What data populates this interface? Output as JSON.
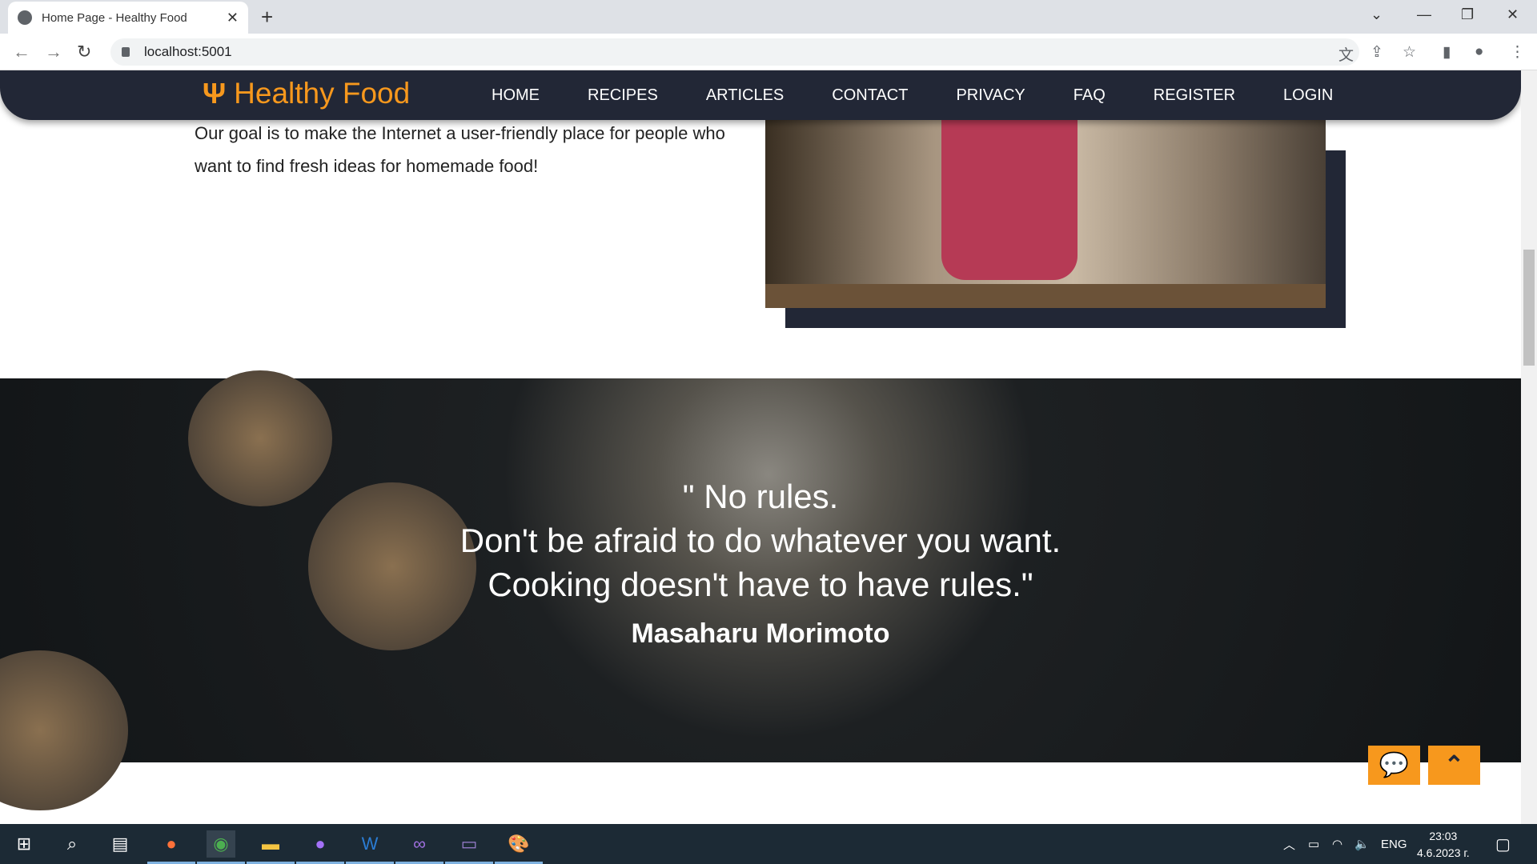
{
  "browser": {
    "tab_title": "Home Page - Healthy Food",
    "url": "localhost:5001"
  },
  "site": {
    "brand": "Healthy Food",
    "nav": [
      "HOME",
      "RECIPES",
      "ARTICLES",
      "CONTACT",
      "PRIVACY",
      "FAQ",
      "REGISTER",
      "LOGIN"
    ]
  },
  "intro": {
    "text": "Our goal is to make the Internet a user-friendly place for people who want to find fresh ideas for homemade food!"
  },
  "quote": {
    "line1": "\" No rules.",
    "line2": "Don't be afraid to do whatever you want.",
    "line3": "Cooking doesn't have to have rules.\"",
    "author": "Masaharu Morimoto"
  },
  "taskbar": {
    "lang": "ENG",
    "time": "23:03",
    "date": "4.6.2023 г."
  },
  "colors": {
    "accent": "#f7981d",
    "navbar": "#222736"
  }
}
